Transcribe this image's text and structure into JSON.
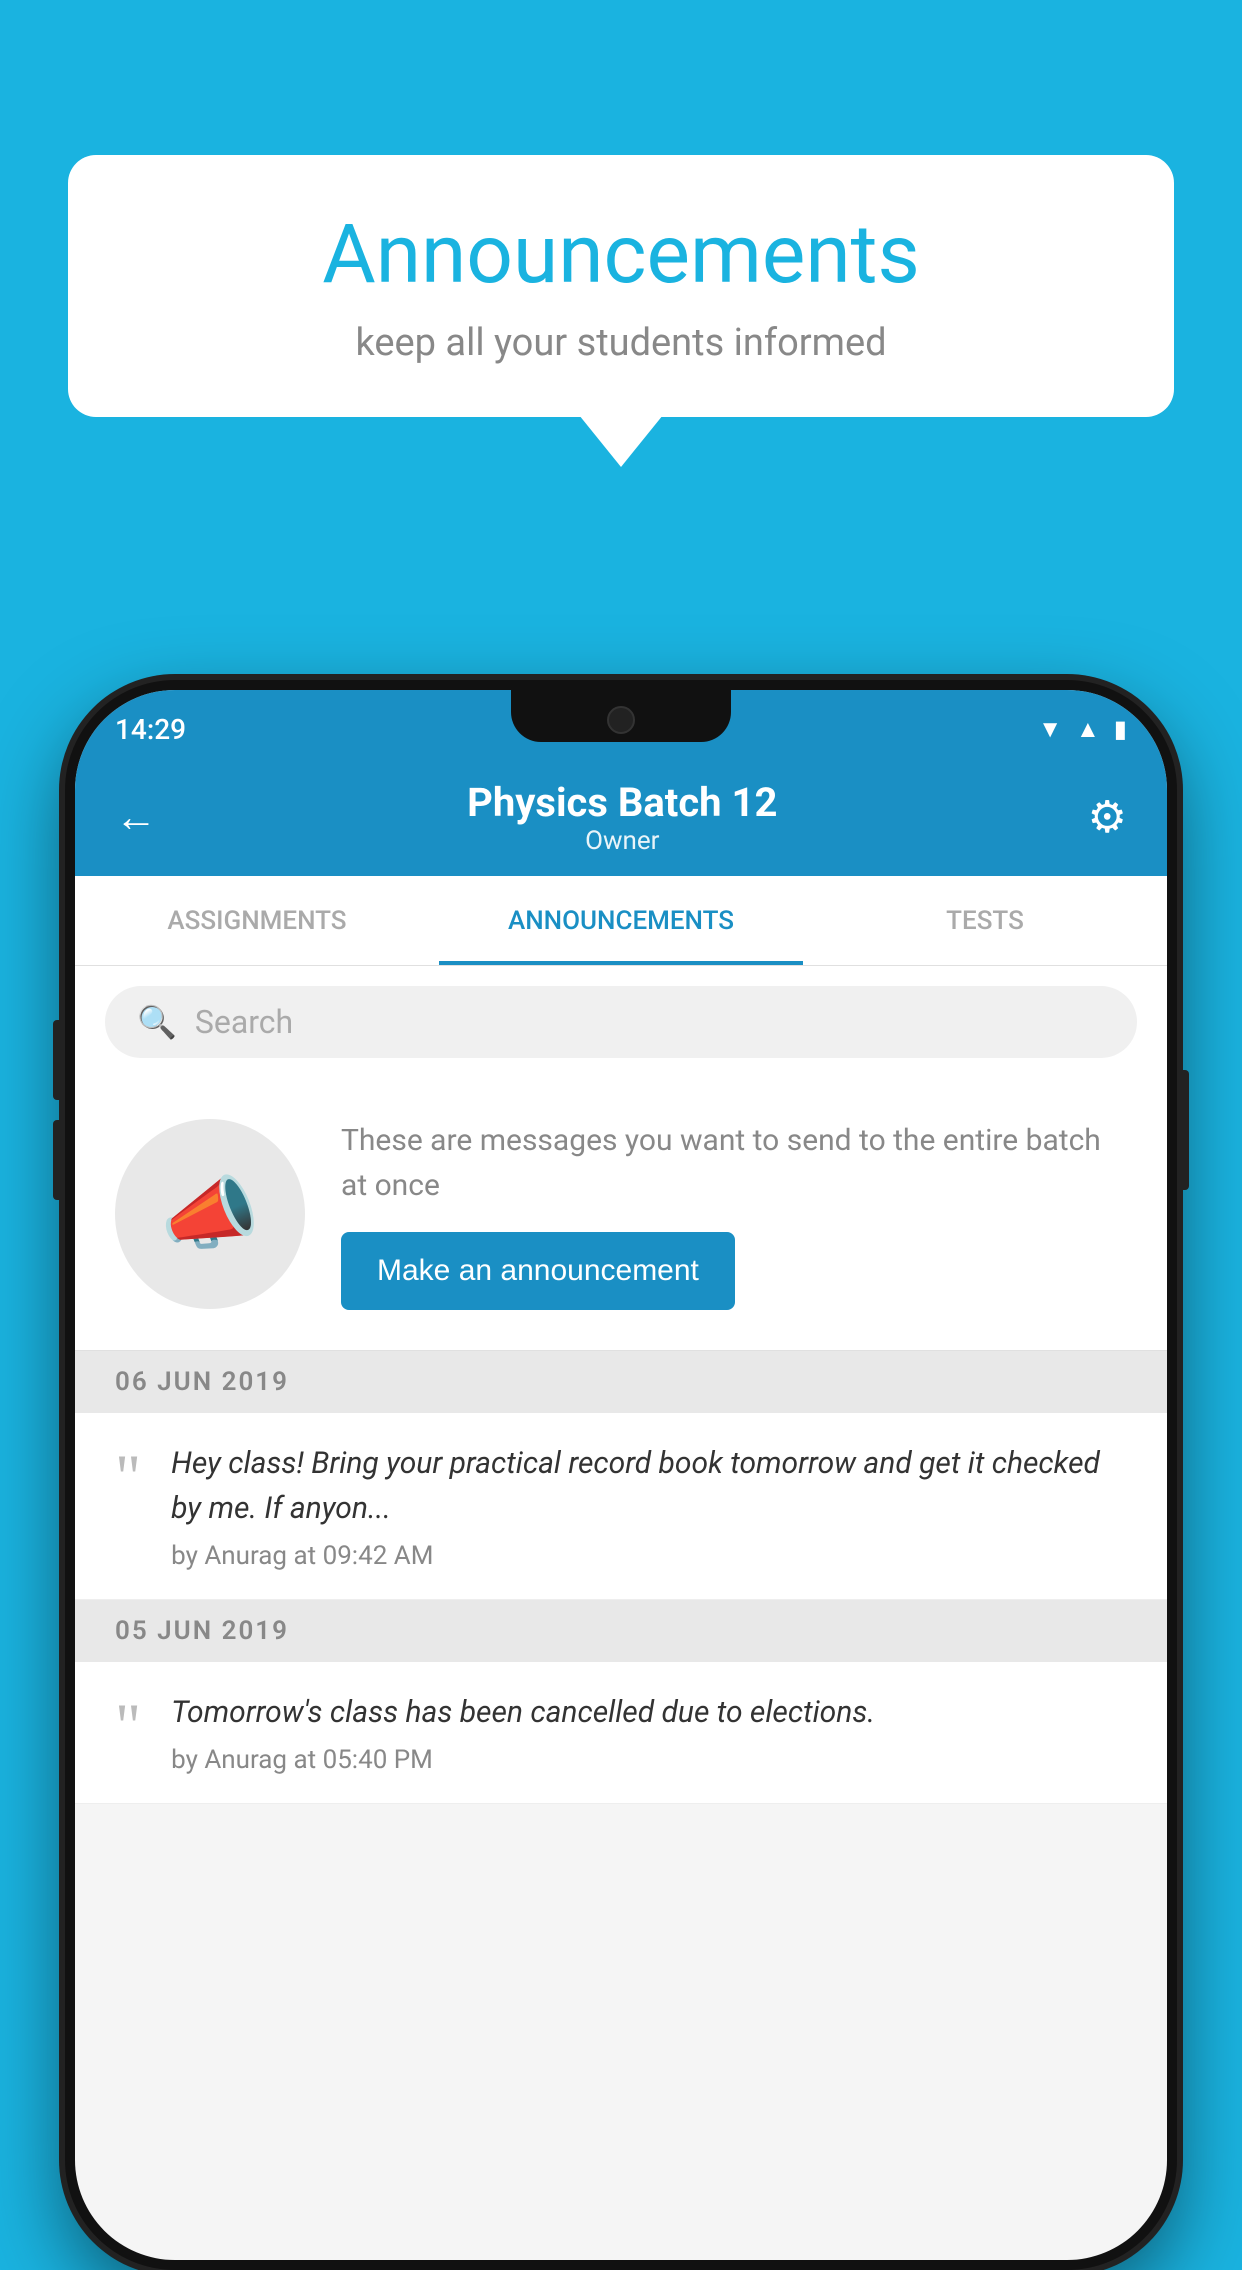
{
  "background_color": "#1ab3e0",
  "speech_bubble": {
    "title": "Announcements",
    "subtitle": "keep all your students informed"
  },
  "phone": {
    "status_bar": {
      "time": "14:29",
      "icons": [
        "wifi",
        "signal",
        "battery"
      ]
    },
    "header": {
      "title": "Physics Batch 12",
      "subtitle": "Owner",
      "back_label": "←",
      "settings_label": "⚙"
    },
    "tabs": [
      {
        "label": "ASSIGNMENTS",
        "active": false
      },
      {
        "label": "ANNOUNCEMENTS",
        "active": true
      },
      {
        "label": "TESTS",
        "active": false
      }
    ],
    "search": {
      "placeholder": "Search"
    },
    "empty_state": {
      "description": "These are messages you want to send to the entire batch at once",
      "button_label": "Make an announcement"
    },
    "date_sections": [
      {
        "date": "06  JUN  2019",
        "announcements": [
          {
            "text": "Hey class! Bring your practical record book tomorrow and get it checked by me. If anyon...",
            "meta": "by Anurag at 09:42 AM"
          }
        ]
      },
      {
        "date": "05  JUN  2019",
        "announcements": [
          {
            "text": "Tomorrow's class has been cancelled due to elections.",
            "meta": "by Anurag at 05:40 PM"
          }
        ]
      }
    ]
  }
}
